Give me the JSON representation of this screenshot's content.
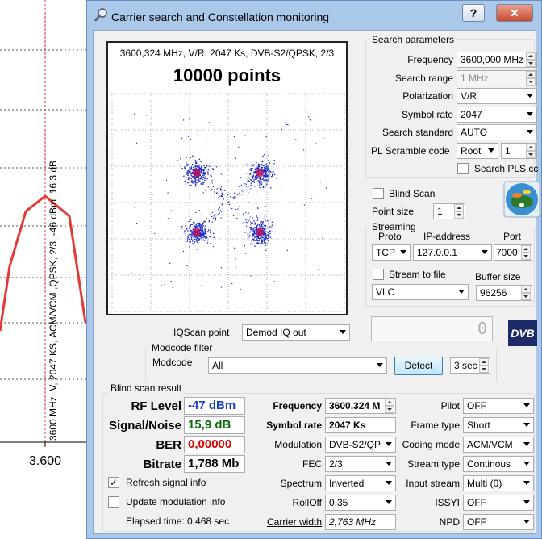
{
  "background": {
    "annotation": "3600 MHz, V, 2047 KS, ACM/VCM ,QPSK, 2/3, -46 dBm, 16,3 dB",
    "axis_tick": "3.600"
  },
  "window": {
    "title": "Carrier search and Constellation monitoring",
    "help_label": "?",
    "close_label": "✕"
  },
  "constellation": {
    "info": "3600,324 MHz, V/R, 2047 Ks, DVB-S2/QPSK, 2/3",
    "points_label": "10000 points",
    "clusters": [
      {
        "i": -0.5,
        "q": 0.5
      },
      {
        "i": 0.5,
        "q": 0.5
      },
      {
        "i": -0.5,
        "q": -0.5
      },
      {
        "i": 0.5,
        "q": -0.5
      }
    ]
  },
  "search": {
    "group_title": "Search parameters",
    "frequency_label": "Frequency",
    "frequency_value": "3600,000 MHz",
    "range_label": "Search range",
    "range_value": "1 MHz",
    "polarization_label": "Polarization",
    "polarization_value": "V/R",
    "symbol_rate_label": "Symbol rate",
    "symbol_rate_value": "2047",
    "standard_label": "Search standard",
    "standard_value": "AUTO",
    "pl_label": "PL Scramble code",
    "pl_mode": "Root",
    "pl_value": "1",
    "search_pls_label": "Search PLS cc"
  },
  "blind": {
    "label": "Blind Scan",
    "point_size_label": "Point size",
    "point_size_value": "1"
  },
  "streaming": {
    "group_title": "Streaming",
    "proto_label": "Proto",
    "proto_value": "TCP",
    "ip_label": "IP-address",
    "ip_value": "127.0.0.1",
    "port_label": "Port",
    "port_value": "7000",
    "stream_file_label": "Stream to file",
    "buffer_label": "Buffer size",
    "player_value": "VLC",
    "buffer_value": "96256"
  },
  "iqscan": {
    "label": "IQScan point",
    "value": "Demod IQ out",
    "counter": "0",
    "logo": "DVB"
  },
  "modcode": {
    "group_title": "Modcode filter",
    "label": "Modcode",
    "value": "All",
    "detect_label": "Detect",
    "interval_value": "3 sec"
  },
  "result": {
    "group_title": "Blind scan result",
    "rf_label": "RF Level",
    "rf_value": "-47 dBm",
    "snr_label": "Signal/Noise",
    "snr_value": "15,9 dB",
    "ber_label": "BER",
    "ber_value": "0,00000",
    "bitrate_label": "Bitrate",
    "bitrate_value": "1,788 Mb",
    "refresh_label": "Refresh signal info",
    "update_mod_label": "Update modulation info",
    "elapsed_label": "Elapsed time: 0.468 sec",
    "frequency_label": "Frequency",
    "frequency_value": "3600,324 M",
    "symbol_rate_label": "Symbol rate",
    "symbol_rate_value": "2047 Ks",
    "modulation_label": "Modulation",
    "modulation_value": "DVB-S2/QP",
    "fec_label": "FEC",
    "fec_value": "2/3",
    "spectrum_label": "Spectrum",
    "spectrum_value": "Inverted",
    "rolloff_label": "RollOff",
    "rolloff_value": "0.35",
    "carrier_width_label": "Carrier width",
    "carrier_width_value": "2,763 MHz",
    "pilot_label": "Pilot",
    "pilot_value": "OFF",
    "frame_label": "Frame type",
    "frame_value": "Short",
    "coding_label": "Coding mode",
    "coding_value": "ACM/VCM",
    "stream_type_label": "Stream type",
    "stream_type_value": "Continous",
    "input_stream_label": "Input stream",
    "input_stream_value": "Multi (0)",
    "issyi_label": "ISSYI",
    "issyi_value": "OFF",
    "npd_label": "NPD",
    "npd_value": "OFF"
  },
  "colors": {
    "window_frame": "#aac8ea",
    "rf_value": "#1a3fd0",
    "snr_value": "#0a6a0a",
    "ber_value": "#e00000",
    "point_color": "#1a2cc8",
    "center_color": "#d0104a",
    "spectrum_line": "#e53935"
  }
}
